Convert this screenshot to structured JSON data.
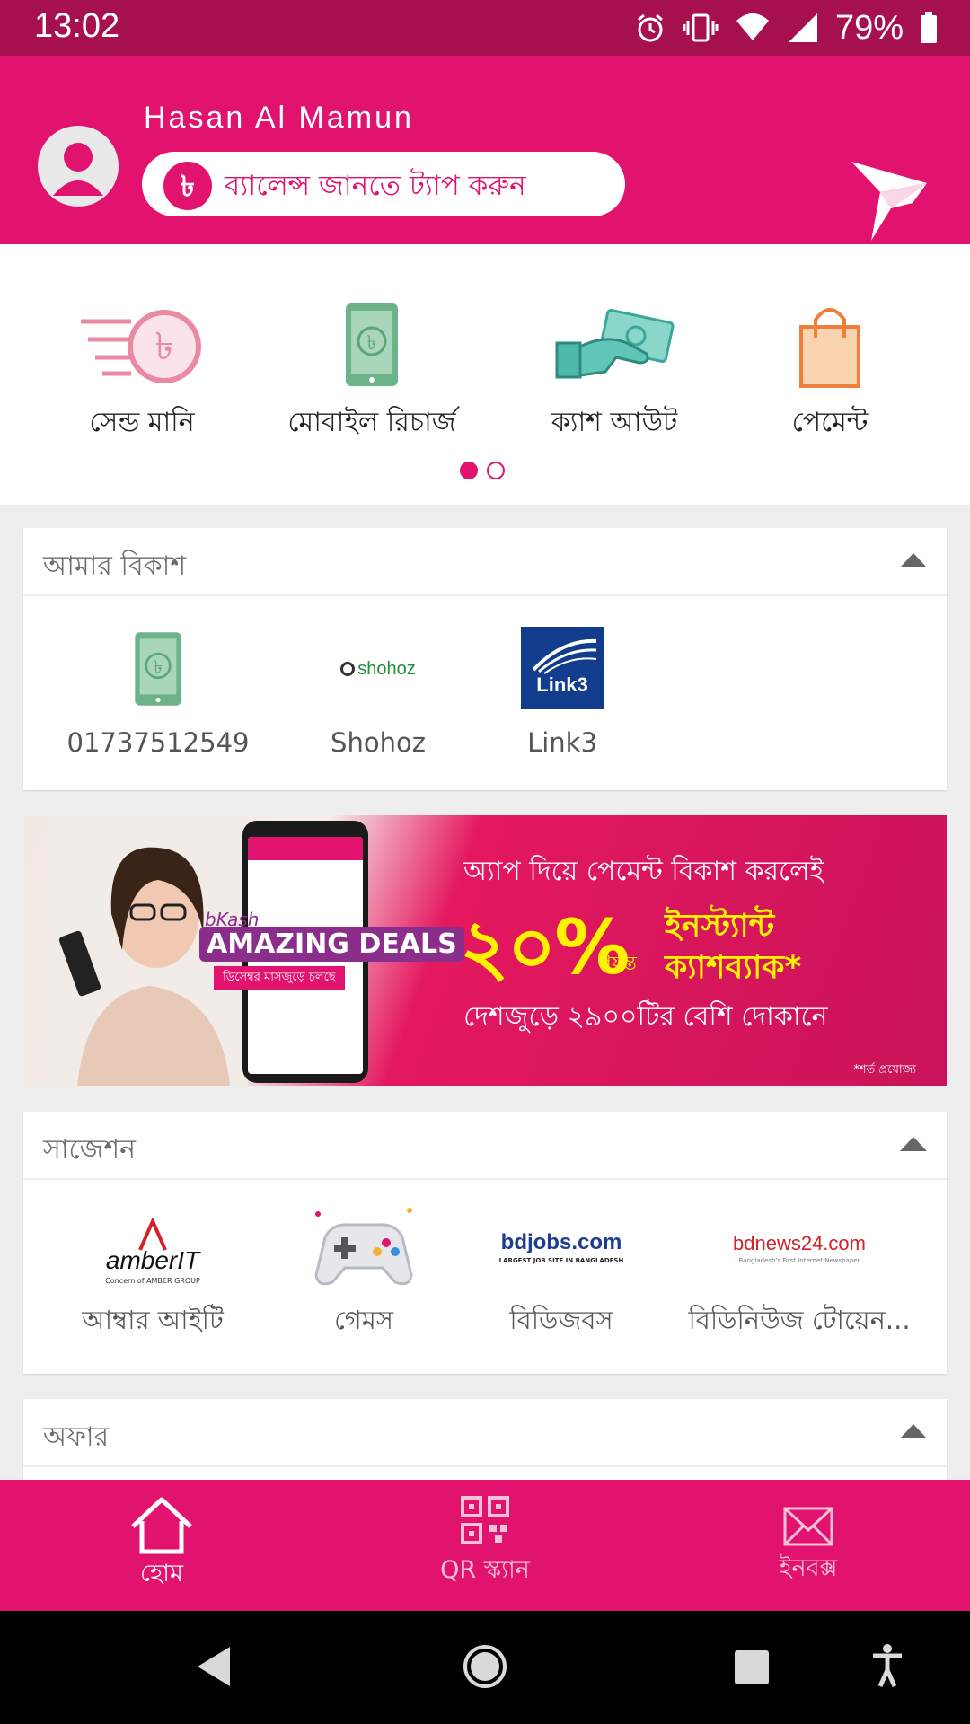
{
  "status_bar": {
    "time": "13:02",
    "battery": "79%"
  },
  "header": {
    "user_name": "Hasan Al Mamun",
    "balance_prompt": "ব্যালেন্স জানতে ট্যাপ করুন",
    "currency_symbol": "৳"
  },
  "quick_actions": [
    {
      "label": "সেন্ড মানি",
      "icon": "send-money-icon"
    },
    {
      "label": "মোবাইল রিচার্জ",
      "icon": "mobile-recharge-icon"
    },
    {
      "label": "ক্যাশ আউট",
      "icon": "cash-out-icon"
    },
    {
      "label": "পেমেন্ট",
      "icon": "payment-bag-icon"
    }
  ],
  "carousel": {
    "pages": 2,
    "active": 1
  },
  "my_bkash": {
    "title": "আমার বিকাশ",
    "items": [
      {
        "label": "01737512549",
        "icon": "mobile-recharge-icon"
      },
      {
        "label": "Shohoz",
        "icon": "shohoz-logo",
        "logo_text": "shohoz"
      },
      {
        "label": "Link3",
        "icon": "link3-logo",
        "logo_text": "Link3"
      }
    ]
  },
  "banner": {
    "line1": "অ্যাপ দিয়ে পেমেন্ট বিকাশ করলেই",
    "percent": "২০%",
    "upto": "পর্যন্ত",
    "cashback_line1": "ইনস্ট্যান্ট",
    "cashback_line2": "ক্যাশব্যাক*",
    "line2": "দেশজুড়ে ২৯০০টির বেশি দোকানে",
    "condition": "*শর্ত প্রযোজ্য",
    "deals_brand": "bKash",
    "deals_title": "AMAZING DEALS",
    "deals_sub": "ডিসেম্বর মাসজুড়ে চলছে"
  },
  "suggestion": {
    "title": "সাজেশন",
    "items": [
      {
        "label": "আম্বার আইটি",
        "icon": "amberit-logo",
        "logo_text": "amberIT",
        "logo_sub": "Concern of AMBER GROUP"
      },
      {
        "label": "গেমস",
        "icon": "game-controller-icon"
      },
      {
        "label": "বিডিজবস",
        "icon": "bdjobs-logo",
        "logo_text": "bdjobs.com",
        "logo_sub": "LARGEST JOB SITE IN BANGLADESH"
      },
      {
        "label": "বিডিনিউজ টোয়েন...",
        "icon": "bdnews24-logo",
        "logo_text": "bdnews24.com",
        "logo_sub": "Bangladesh's First Internet Newspaper"
      }
    ]
  },
  "offer": {
    "title": "অফার"
  },
  "bottom_nav": [
    {
      "label": "হোম",
      "icon": "home-icon",
      "active": true
    },
    {
      "label": "QR স্ক্যান",
      "icon": "qr-code-icon",
      "active": false
    },
    {
      "label": "ইনবক্স",
      "icon": "mail-icon",
      "active": false
    }
  ],
  "colors": {
    "primary": "#e2136e",
    "status_bar": "#a7104f",
    "accent_green": "#5aa67a"
  }
}
